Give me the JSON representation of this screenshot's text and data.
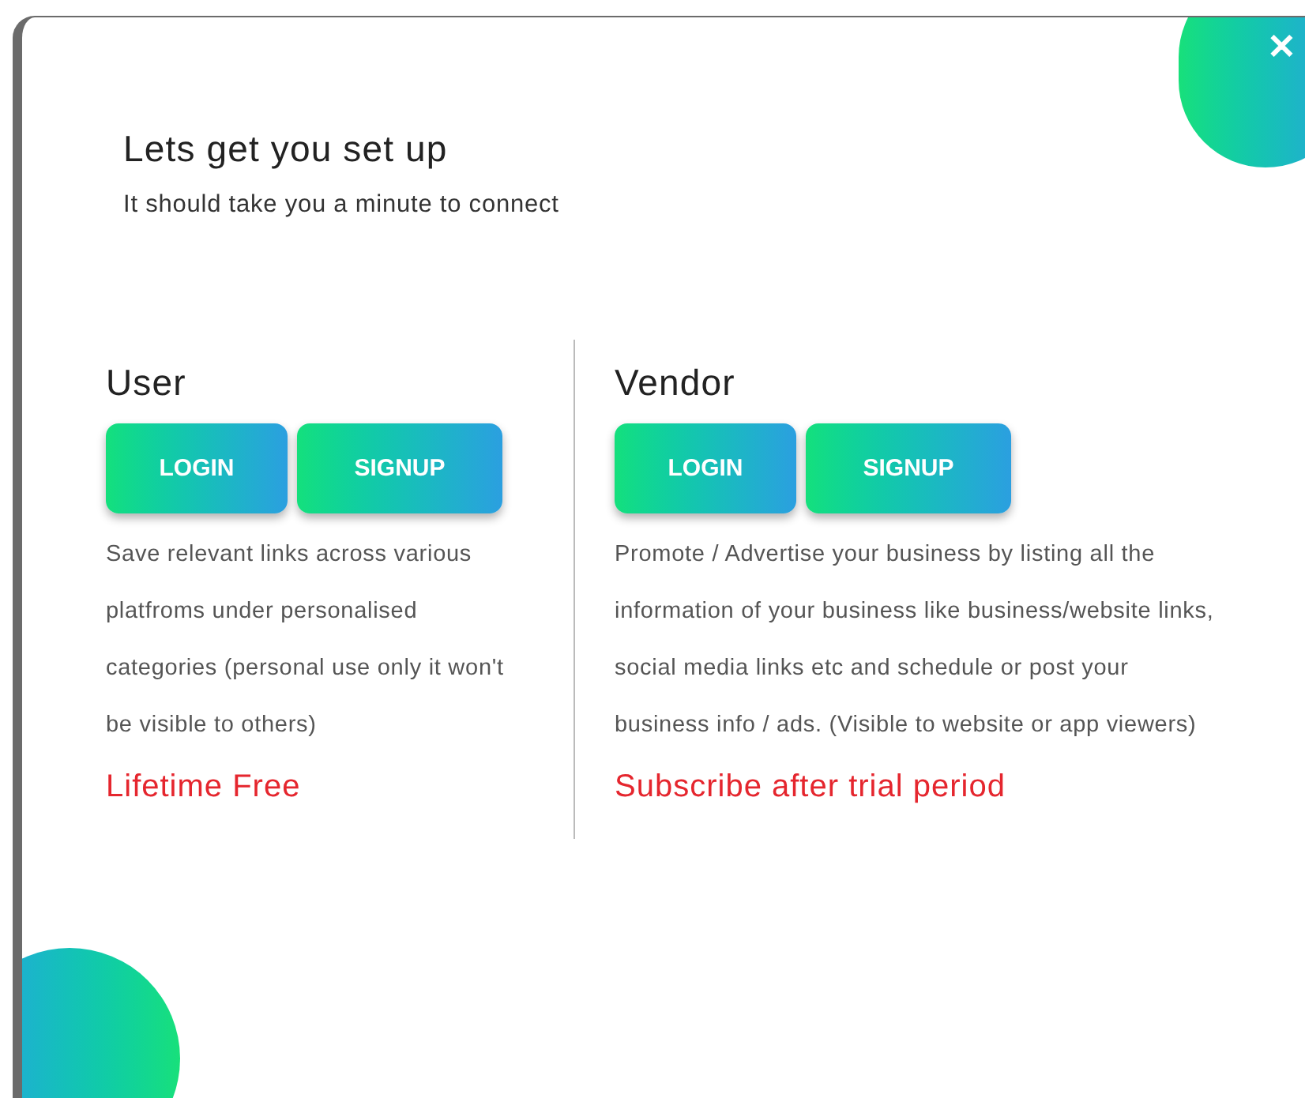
{
  "close_button": {
    "label": "✕"
  },
  "header": {
    "title": "Lets get you set up",
    "subtitle": "It should take you a minute to connect"
  },
  "sections": [
    {
      "heading": "User",
      "buttons": [
        "LOGIN",
        "SIGNUP"
      ],
      "description": "Save relevant links across various platfroms under personalised categories (personal use only it won't be visible to others)",
      "pricing": "Lifetime Free"
    },
    {
      "heading": "Vendor",
      "buttons": [
        "LOGIN",
        "SIGNUP"
      ],
      "description": "Promote / Advertise your business by listing all the information of your business like business/website links, social media links etc and schedule or post your business info / ads. (Visible to website or app viewers)",
      "pricing": "Subscribe after trial period"
    }
  ]
}
